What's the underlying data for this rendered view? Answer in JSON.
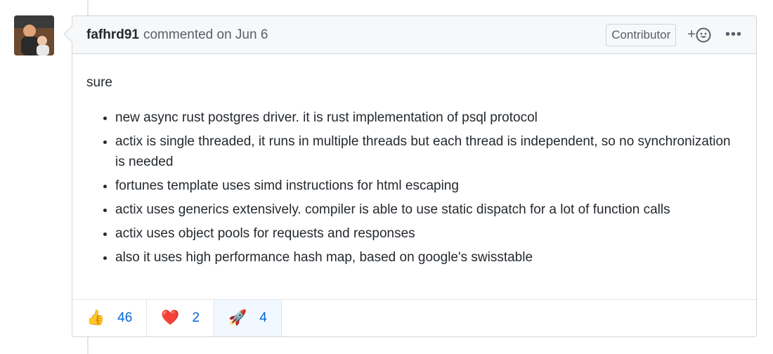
{
  "comment": {
    "author": "fafhrd91",
    "action_text": "commented on Jun 6",
    "badge": "Contributor",
    "add_reaction_label": "+",
    "more_label": "•••",
    "body_intro": "sure",
    "items": [
      "new async rust postgres driver. it is rust implementation of psql protocol",
      "actix is single threaded, it runs in multiple threads but each thread is independent, so no synchronization is needed",
      "fortunes template uses simd instructions for html escaping",
      "actix uses generics extensively. compiler is able to use static dispatch for a lot of function calls",
      "actix uses object pools for requests and responses",
      "also it uses high performance hash map, based on google's swisstable"
    ],
    "reactions": [
      {
        "icon": "thumbs-up-icon",
        "emoji": "👍",
        "count": "46"
      },
      {
        "icon": "heart-icon",
        "emoji": "❤️",
        "count": "2"
      },
      {
        "icon": "rocket-icon",
        "emoji": "🚀",
        "count": "4"
      }
    ]
  },
  "colors": {
    "link": "#0366d6",
    "header_bg": "#f6f8fa",
    "border": "#d1d5da",
    "active_reaction_bg": "#f1f8ff"
  }
}
